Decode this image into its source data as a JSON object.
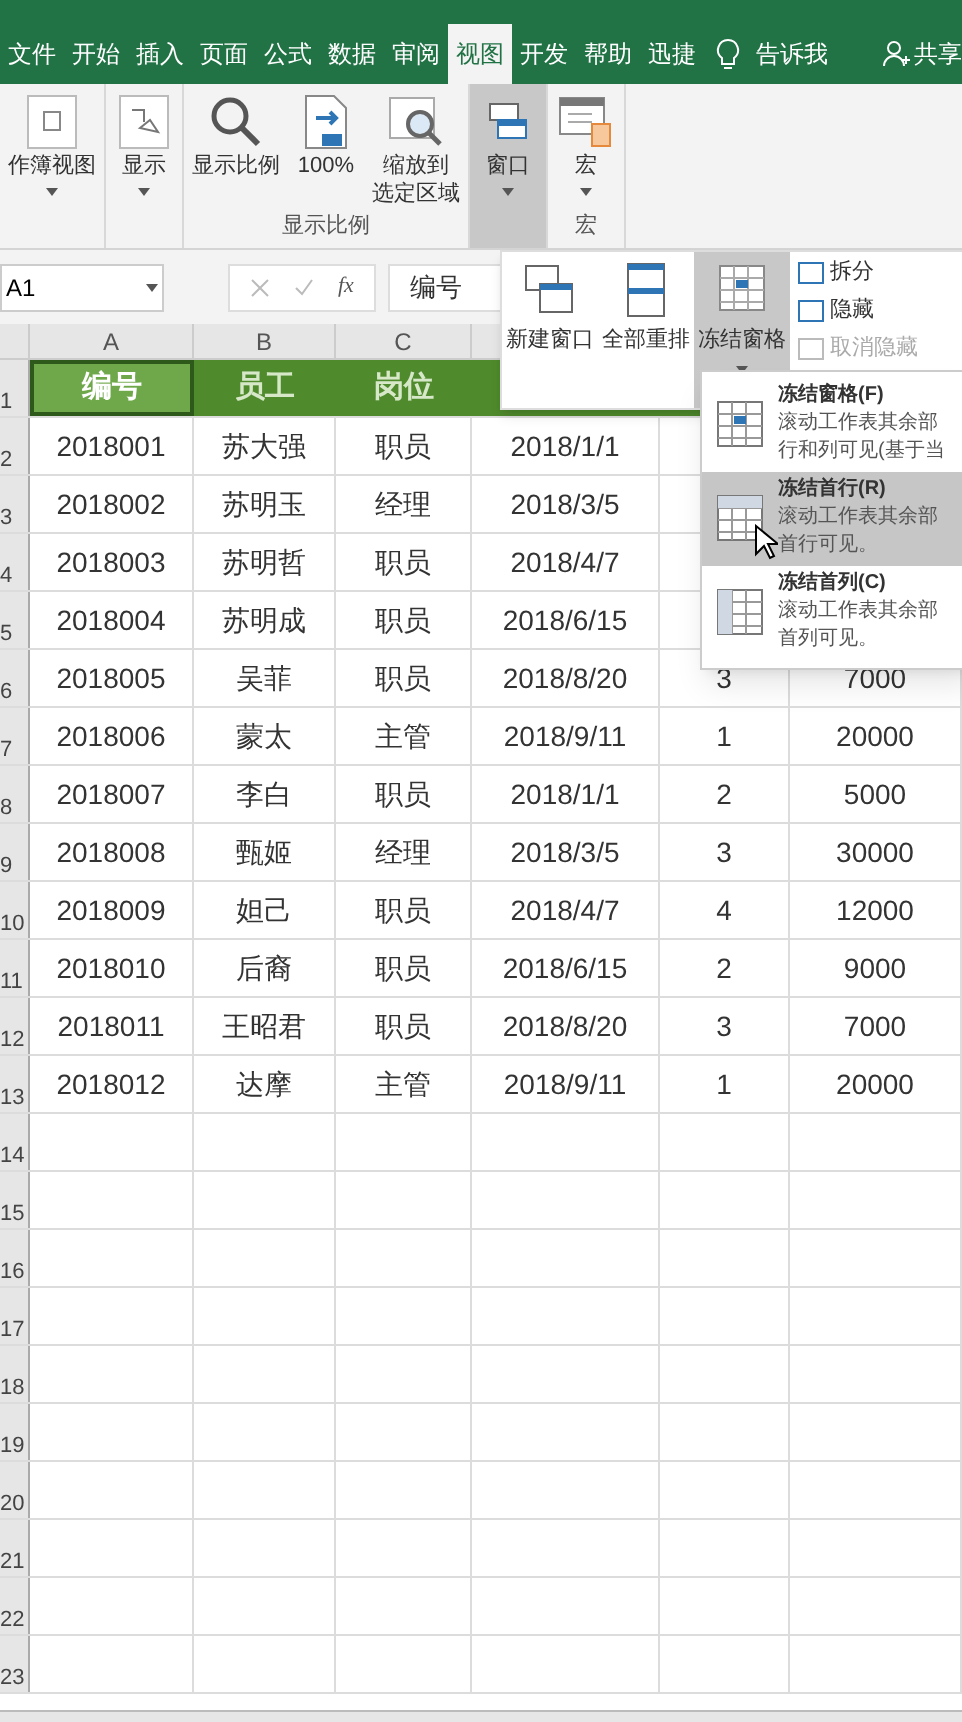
{
  "tabs": [
    {
      "label": "文件",
      "selected": false
    },
    {
      "label": "开始",
      "selected": false
    },
    {
      "label": "插入",
      "selected": false
    },
    {
      "label": "页面",
      "selected": false
    },
    {
      "label": "公式",
      "selected": false
    },
    {
      "label": "数据",
      "selected": false
    },
    {
      "label": "审阅",
      "selected": false
    },
    {
      "label": "视图",
      "selected": true
    },
    {
      "label": "开发",
      "selected": false
    },
    {
      "label": "帮助",
      "selected": false
    },
    {
      "label": "迅捷",
      "selected": false
    }
  ],
  "tell_me": "告诉我",
  "share": "共享",
  "ribbon": [
    {
      "buttons": [
        {
          "lines": [
            "作簿视图"
          ],
          "dropdown": true,
          "pressed": false
        }
      ]
    },
    {
      "buttons": [
        {
          "lines": [
            "显示"
          ],
          "dropdown": true,
          "pressed": false
        }
      ]
    },
    {
      "label": "显示比例",
      "buttons": [
        {
          "lines": [
            "显示比例"
          ],
          "dropdown": false,
          "pressed": false
        },
        {
          "lines": [
            "100%"
          ],
          "dropdown": false,
          "pressed": false
        },
        {
          "lines": [
            "缩放到",
            "选定区域"
          ],
          "dropdown": false,
          "pressed": false
        }
      ]
    },
    {
      "buttons": [
        {
          "lines": [
            "窗口"
          ],
          "dropdown": true,
          "pressed": true
        }
      ]
    },
    {
      "label": "宏",
      "buttons": [
        {
          "lines": [
            "宏"
          ],
          "dropdown": true,
          "pressed": false
        }
      ]
    }
  ],
  "name_box": "A1",
  "function_label": "fx",
  "formula": "编号",
  "window_panel": {
    "buttons": [
      {
        "label": "新建窗口",
        "pressed": false,
        "dropdown": false
      },
      {
        "label": "全部重排",
        "pressed": false,
        "dropdown": false
      },
      {
        "label": "冻结窗格",
        "pressed": true,
        "dropdown": true
      }
    ],
    "small": [
      {
        "label": "拆分",
        "disabled": false
      },
      {
        "label": "隐藏",
        "disabled": false
      },
      {
        "label": "取消隐藏",
        "disabled": true
      }
    ]
  },
  "freeze_menu": [
    {
      "title": "冻结窗格(F)",
      "lines": [
        "滚动工作表其余部",
        "行和列可见(基于当"
      ],
      "selected": false
    },
    {
      "title": "冻结首行(R)",
      "lines": [
        "滚动工作表其余部",
        "首行可见。"
      ],
      "selected": true
    },
    {
      "title": "冻结首列(C)",
      "lines": [
        "滚动工作表其余部",
        "首列可见。"
      ],
      "selected": false
    }
  ],
  "columns": [
    "A",
    "B",
    "C"
  ],
  "header_row": [
    {
      "text": "编号",
      "selected": true
    },
    {
      "text": "员工",
      "selected": false
    },
    {
      "text": "岗位",
      "selected": false
    }
  ],
  "rows": [
    [
      "2018001",
      "苏大强",
      "职员",
      "2018/1/1"
    ],
    [
      "2018002",
      "苏明玉",
      "经理",
      "2018/3/5"
    ],
    [
      "2018003",
      "苏明哲",
      "职员",
      "2018/4/7"
    ],
    [
      "2018004",
      "苏明成",
      "职员",
      "2018/6/15"
    ],
    [
      "2018005",
      "吴菲",
      "职员",
      "2018/8/20",
      "3",
      "7000"
    ],
    [
      "2018006",
      "蒙太",
      "主管",
      "2018/9/11",
      "1",
      "20000"
    ],
    [
      "2018007",
      "李白",
      "职员",
      "2018/1/1",
      "2",
      "5000"
    ],
    [
      "2018008",
      "甄姬",
      "经理",
      "2018/3/5",
      "3",
      "30000"
    ],
    [
      "2018009",
      "妲己",
      "职员",
      "2018/4/7",
      "4",
      "12000"
    ],
    [
      "2018010",
      "后裔",
      "职员",
      "2018/6/15",
      "2",
      "9000"
    ],
    [
      "2018011",
      "王昭君",
      "职员",
      "2018/8/20",
      "3",
      "7000"
    ],
    [
      "2018012",
      "达摩",
      "主管",
      "2018/9/11",
      "1",
      "20000"
    ]
  ],
  "row_numbers": [
    "1",
    "2",
    "3",
    "4",
    "5",
    "6",
    "7",
    "8",
    "9",
    "10",
    "11",
    "12",
    "13",
    "14",
    "15",
    "16",
    "17",
    "18",
    "19",
    "20",
    "21",
    "22",
    "23"
  ]
}
